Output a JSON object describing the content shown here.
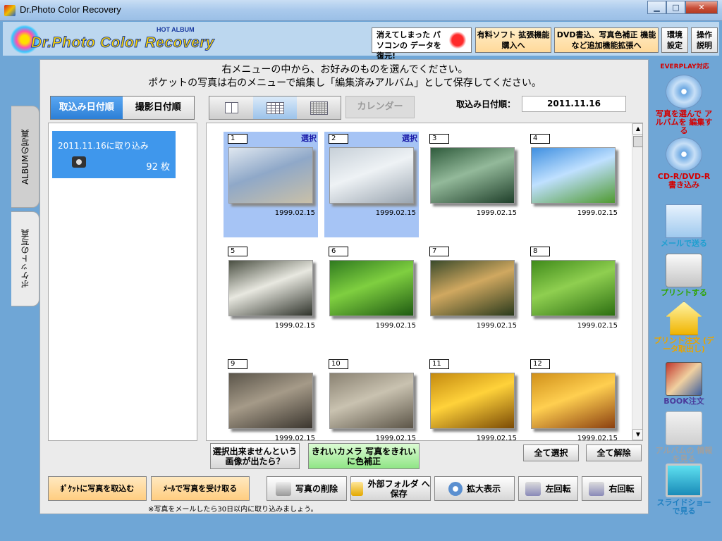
{
  "window": {
    "title": "Dr.Photo Color Recovery"
  },
  "header": {
    "logo_badge": "HOT ALBUM",
    "logo_text": "Dr.Photo Color Recovery",
    "restore_text": "消えてしまった パソコンの データを復元!",
    "purchase_label": "有料ソフト 拡張機能購入へ",
    "dvd_label": "DVD書込、写真色補正 機能など追加機能拡張へ",
    "settings_label": "環境 設定",
    "help_label": "操作 説明"
  },
  "instructions": {
    "line1": "右メニューの中から、お好みのものを選んでください。",
    "line2": "ポケットの写真は右のメニューで編集し「編集済みアルバム」として保存してください。"
  },
  "tabs": {
    "album": "ALBUMの写真",
    "pocket": "ポケットの写真"
  },
  "sort": {
    "by_import": "取込み日付順",
    "by_shot": "撮影日付順"
  },
  "view": {
    "calendar_label": "カレンダー",
    "sort_label": "取込み日付順：",
    "current_date": "2011.11.16"
  },
  "import_item": {
    "label": "2011.11.16に取り込み",
    "count": "92 枚"
  },
  "photos": [
    {
      "num": "1",
      "date": "1999.02.15",
      "selected": true,
      "sel_label": "選択",
      "colors": [
        "#dfe7f0",
        "#8fa8c8",
        "#c9c0a8"
      ]
    },
    {
      "num": "2",
      "date": "1999.02.15",
      "selected": true,
      "sel_label": "選択",
      "colors": [
        "#c7d0d8",
        "#eef2f5",
        "#9aa5b0"
      ]
    },
    {
      "num": "3",
      "date": "1999.02.15",
      "selected": false,
      "sel_label": "",
      "colors": [
        "#2f5b3c",
        "#93b99a",
        "#1f3f2a"
      ]
    },
    {
      "num": "4",
      "date": "1999.02.15",
      "selected": false,
      "sel_label": "",
      "colors": [
        "#3f8fe0",
        "#bfe0ff",
        "#4f9a30"
      ]
    },
    {
      "num": "5",
      "date": "1999.02.15",
      "selected": false,
      "sel_label": "",
      "colors": [
        "#4a4f42",
        "#e8e8e0",
        "#2f332b"
      ]
    },
    {
      "num": "6",
      "date": "1999.02.15",
      "selected": false,
      "sel_label": "",
      "colors": [
        "#2f7a1f",
        "#7fcf40",
        "#1f5a12"
      ]
    },
    {
      "num": "7",
      "date": "1999.02.15",
      "selected": false,
      "sel_label": "",
      "colors": [
        "#3a4a2a",
        "#d0a860",
        "#2a3a1c"
      ]
    },
    {
      "num": "8",
      "date": "1999.02.15",
      "selected": false,
      "sel_label": "",
      "colors": [
        "#3f8a1a",
        "#8fcf50",
        "#2d6f12"
      ]
    },
    {
      "num": "9",
      "date": "1999.02.15",
      "selected": false,
      "sel_label": "",
      "colors": [
        "#5b554a",
        "#a59a88",
        "#3a352e"
      ]
    },
    {
      "num": "10",
      "date": "1999.02.15",
      "selected": false,
      "sel_label": "",
      "colors": [
        "#8a8272",
        "#c9c2b0",
        "#5b5447"
      ]
    },
    {
      "num": "11",
      "date": "1999.02.15",
      "selected": false,
      "sel_label": "",
      "colors": [
        "#c48a10",
        "#ffd23a",
        "#7a4a05"
      ]
    },
    {
      "num": "12",
      "date": "1999.02.15",
      "selected": false,
      "sel_label": "",
      "colors": [
        "#d0901a",
        "#ffcf50",
        "#8a3f10"
      ]
    }
  ],
  "buttons": {
    "unselectable": "選択出来ませんという 画像が出たら？",
    "clean": "きれいカメラ 写真をきれいに色補正",
    "select_all": "全て選択",
    "deselect_all": "全て解除",
    "pocket_import": "ﾎﾟｹｯﾄに写真を取込む",
    "mail_receive": "ﾒｰﾙで写真を受け取る",
    "delete": "写真の削除",
    "external_save": "外部フォルダ へ保存",
    "zoom": "拡大表示",
    "rotate_left": "左回転",
    "rotate_right": "右回転",
    "note": "※写真をメールしたら30日以内に取り込みましょう。"
  },
  "sidebar": {
    "everplay": "EVERPLAY対応",
    "items": [
      {
        "label": "写真を選んで アルバムを 編集する",
        "color": "#d40000",
        "icon": "cd-icon"
      },
      {
        "label": "CD-R/DVD-R 書き込み",
        "color": "#d40000",
        "icon": "cd-dvd-icon"
      },
      {
        "label": "メールで送る",
        "color": "#1f9fd0",
        "icon": "mail-icon"
      },
      {
        "label": "プリントする",
        "color": "#2fa400",
        "icon": "printer-icon"
      },
      {
        "label": "プリント注文 (データ取出し)",
        "color": "#e8a400",
        "icon": "house-icon"
      },
      {
        "label": "BOOK注文",
        "color": "#4a3a9a",
        "icon": "book-icon"
      },
      {
        "label": "アルバムの 情報を見る",
        "color": "#a0a0a0",
        "icon": "album-info-icon"
      },
      {
        "label": "スライドショー で見る",
        "color": "#1f7fc0",
        "icon": "slideshow-icon"
      }
    ]
  },
  "colors": {
    "accent": "#3f97ec",
    "background": "#6fa6d6"
  }
}
